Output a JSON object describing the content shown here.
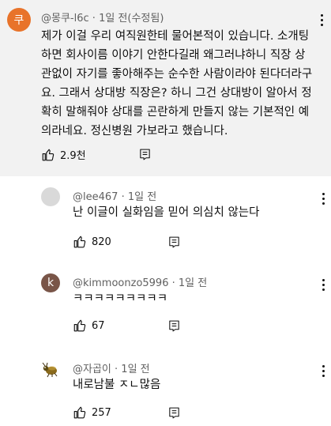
{
  "main_comment": {
    "avatar_letter": "쿠",
    "avatar_color": "#e8732a",
    "handle": "@몽쿠-l6c",
    "meta": "1일 전(수정됨)",
    "text_lines": [
      "제가 이걸 우리 여직원한테 물어본적이 있습니다.  소개팅",
      "하면 회사이름 이야기 안한다길래  왜그러냐하니 직장 상",
      "관없이 자기를 좋아해주는 순수한 사람이라야 된다더라구",
      "요. 그래서 상대방 직장은? 하니 그건 상대방이 알아서 정",
      "확히 말해줘야 상대를 곤란하게 만들지 않는 기본적인 예",
      "의라네요. 정신병원 가보라고 했습니다."
    ],
    "likes": "2.9천"
  },
  "replies": [
    {
      "handle": "@lee467",
      "meta": "1일 전",
      "text": "난 이글이 실화임을 믿어 의심치 않는다",
      "likes": "820",
      "avatar_letter": "",
      "avatar_color": "#d9d9d9"
    },
    {
      "handle": "@kimmoonzo5996",
      "meta": "1일 전",
      "text": "ㅋㅋㅋㅋㅋㅋㅋㅋㅋ",
      "likes": "67",
      "avatar_letter": "k",
      "avatar_color": "#795548"
    },
    {
      "handle": "@자곱이",
      "meta": "1일 전",
      "text": "내로남불 ㅈㄴ많음",
      "likes": "257",
      "avatar_letter": "",
      "avatar_color": "#ffffff"
    }
  ],
  "icons": {
    "like": "thumbs-up-icon",
    "reply": "reply-icon",
    "more": "more-vert-icon"
  }
}
